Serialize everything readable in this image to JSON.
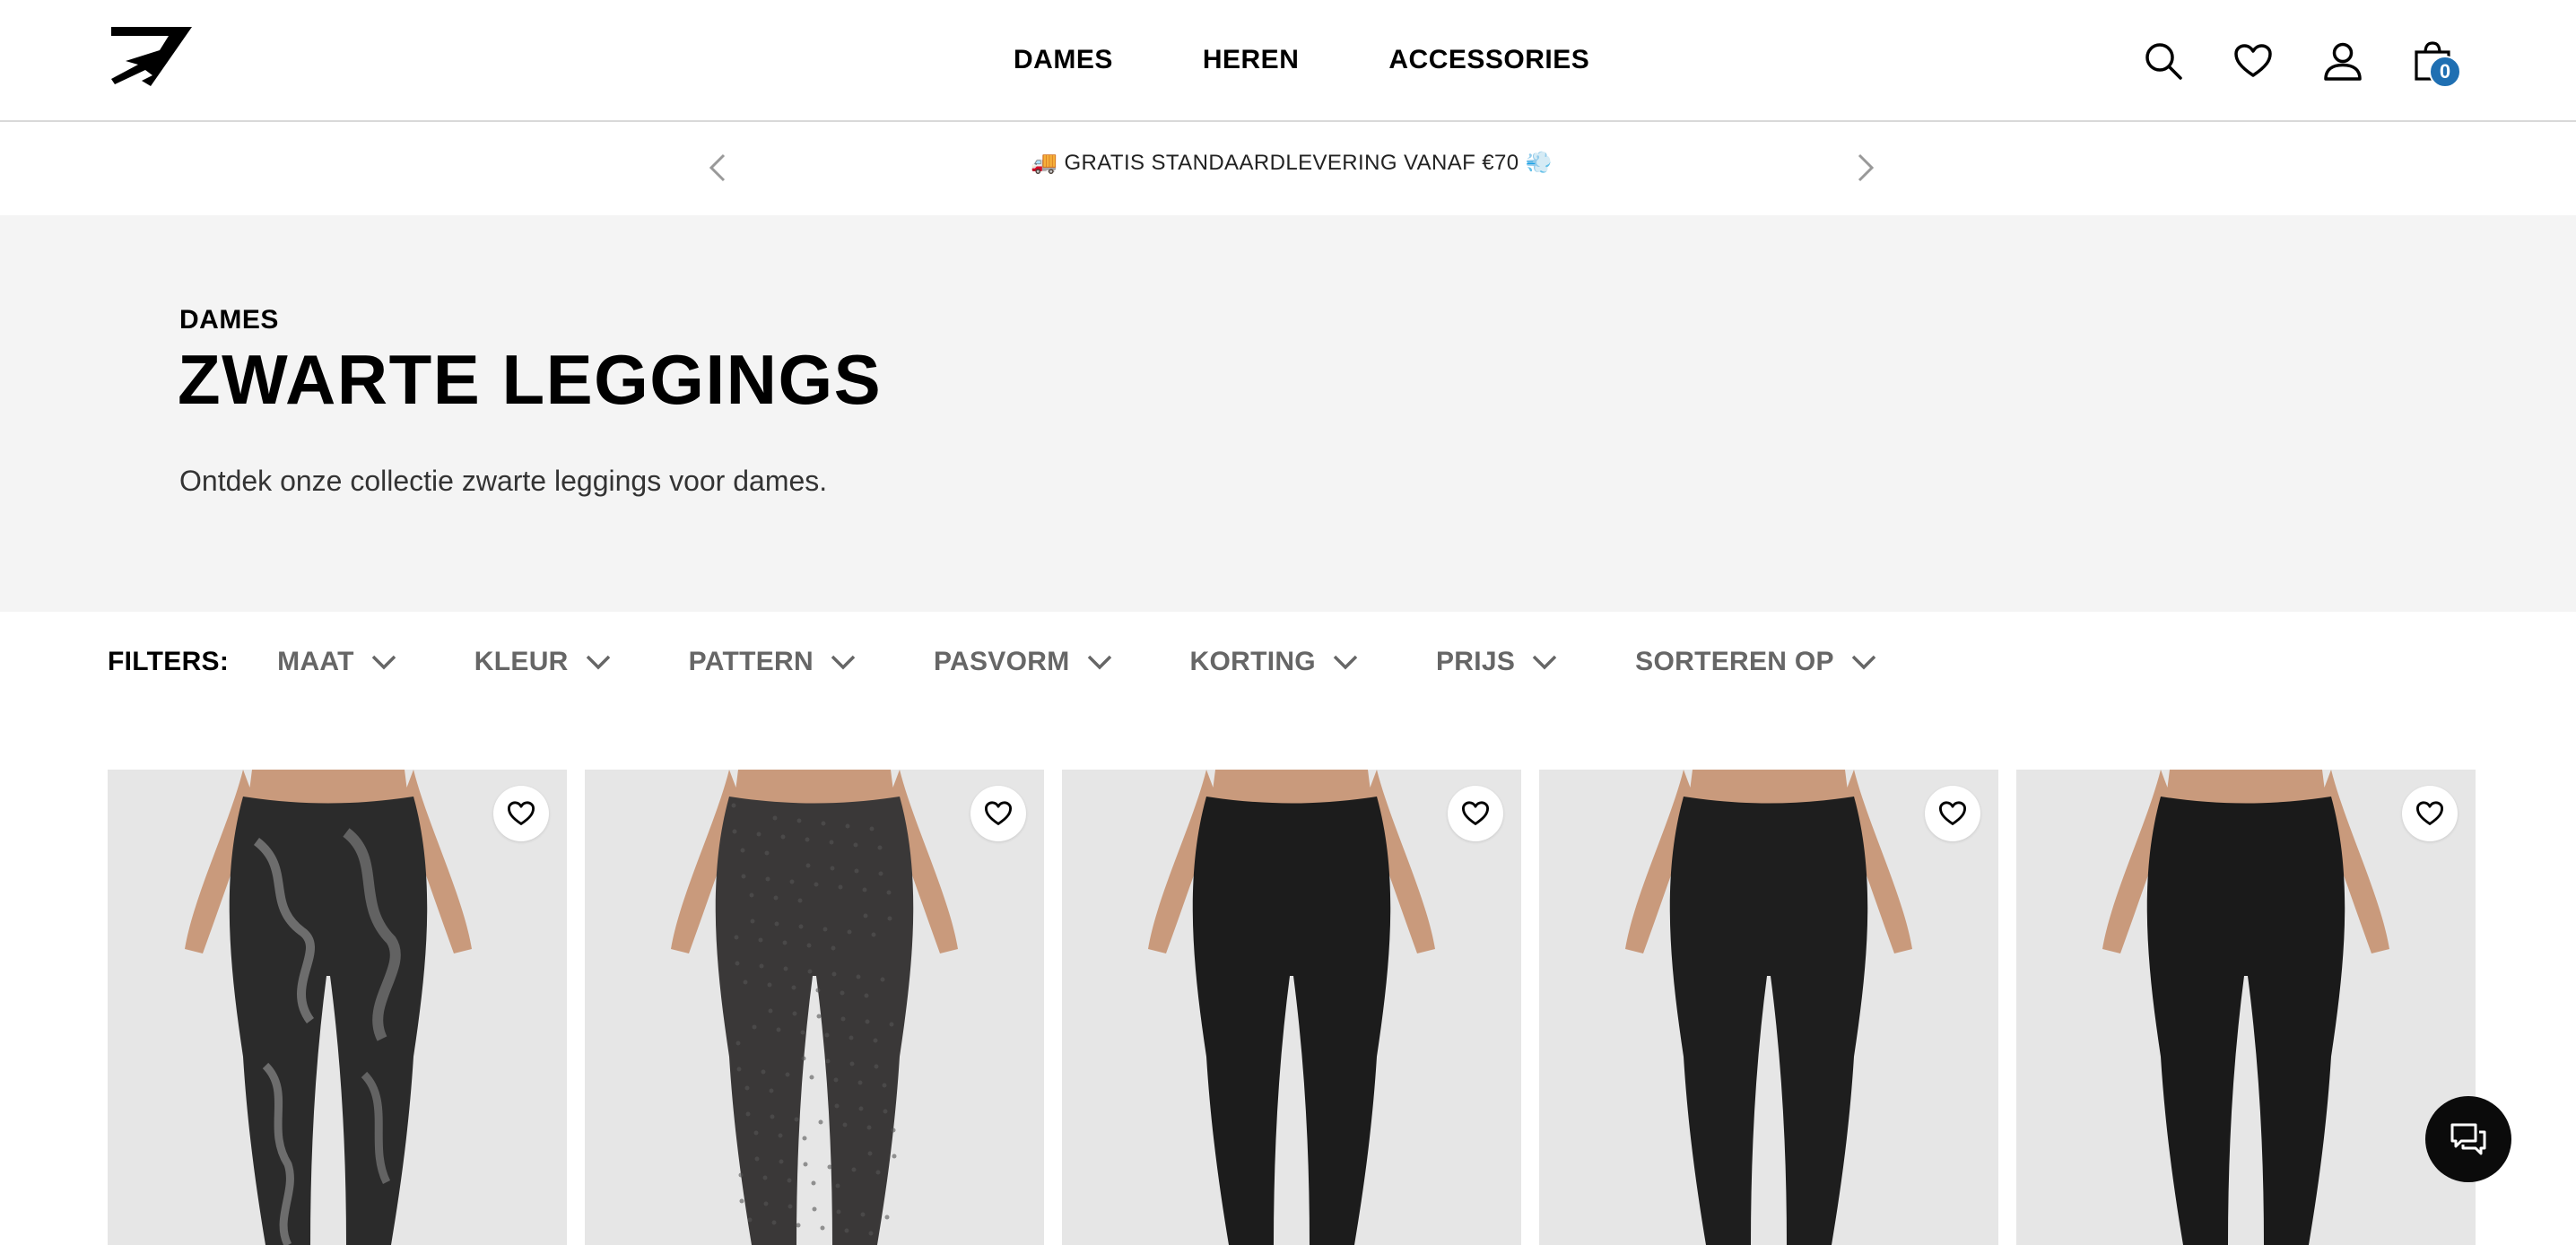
{
  "header": {
    "logo_icon": "gymshark-logo-icon",
    "nav": [
      {
        "label": "DAMES"
      },
      {
        "label": "HEREN"
      },
      {
        "label": "ACCESSORIES"
      }
    ],
    "icons": [
      "search-icon",
      "heart-icon",
      "account-icon",
      "bag-icon"
    ],
    "cart_count": "0",
    "badge_color": "#1f6fb2"
  },
  "promo": {
    "text": "🚚 GRATIS STANDAARDLEVERING VANAF €70 💨",
    "prev_icon": "chevron-left-icon",
    "next_icon": "chevron-right-icon"
  },
  "hero": {
    "crumb": "DAMES",
    "title": "ZWARTE LEGGINGS",
    "description": "Ontdek onze collectie zwarte leggings voor dames."
  },
  "filters": {
    "label": "FILTERS:",
    "items": [
      {
        "label": "MAAT"
      },
      {
        "label": "KLEUR"
      },
      {
        "label": "PATTERN"
      },
      {
        "label": "PASVORM"
      },
      {
        "label": "KORTING"
      },
      {
        "label": "PRIJS"
      },
      {
        "label": "SORTEREN OP"
      }
    ]
  },
  "products": [
    {
      "legging_color": "#2b2b2b",
      "pattern": "marble",
      "wishlist_icon": "heart-icon"
    },
    {
      "legging_color": "#3a3838",
      "pattern": "speckle",
      "wishlist_icon": "heart-icon"
    },
    {
      "legging_color": "#1c1c1c",
      "pattern": "solid",
      "wishlist_icon": "heart-icon"
    },
    {
      "legging_color": "#1e1e1e",
      "pattern": "solid",
      "wishlist_icon": "heart-icon"
    },
    {
      "legging_color": "#1a1a1a",
      "pattern": "solid",
      "wishlist_icon": "heart-icon"
    }
  ],
  "chat": {
    "icon": "chat-icon"
  }
}
